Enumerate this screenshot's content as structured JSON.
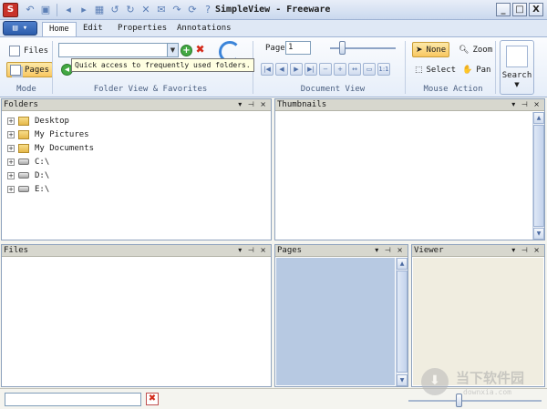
{
  "window": {
    "app_icon_letter": "S",
    "title": "SimpleView - Freeware",
    "qat_icons": [
      "undo-icon",
      "save-icon",
      "back-icon",
      "forward-icon",
      "grid-icon",
      "rotate-left-icon",
      "rotate-right-icon",
      "delete-icon",
      "email-icon",
      "redo-icon",
      "refresh-icon",
      "help-icon"
    ],
    "controls": {
      "minimize": "_",
      "maximize": "□",
      "close": "X"
    }
  },
  "tabs": [
    "Home",
    "Edit",
    "Properties",
    "Annotations"
  ],
  "active_tab": "Home",
  "ribbon": {
    "mode": {
      "label": "Mode",
      "files": "Files",
      "pages": "Pages"
    },
    "folder_view": {
      "label": "Folder View & Favorites",
      "combo_value": "",
      "tooltip": "Quick access to frequently used folders."
    },
    "document_view": {
      "label": "Document View",
      "page_label": "Page",
      "page_value": "1",
      "page_slider_fraction": 0.14,
      "nav_icons": [
        "first-page-icon",
        "prev-page-icon",
        "next-page-icon",
        "last-page-icon",
        "zoom-out-icon",
        "zoom-in-icon",
        "fit-width-icon",
        "fit-page-icon",
        "actual-size-icon"
      ]
    },
    "mouse_action": {
      "label": "Mouse Action",
      "none": "None",
      "zoom": "Zoom",
      "select": "Select",
      "pan": "Pan"
    },
    "search": {
      "label": "Search"
    }
  },
  "panes": {
    "folders": {
      "title": "Folders",
      "items": [
        {
          "label": "Desktop",
          "type": "folder"
        },
        {
          "label": "My Pictures",
          "type": "folder"
        },
        {
          "label": "My Documents",
          "type": "folder"
        },
        {
          "label": "C:\\",
          "type": "drive"
        },
        {
          "label": "D:\\",
          "type": "drive"
        },
        {
          "label": "E:\\",
          "type": "drive"
        }
      ]
    },
    "thumbnails": {
      "title": "Thumbnails"
    },
    "files": {
      "title": "Files"
    },
    "pages": {
      "title": "Pages"
    },
    "viewer": {
      "title": "Viewer"
    },
    "tool_glyphs": "▾ ⊣ ×"
  },
  "statusbar": {
    "search_value": "",
    "zoom_slider_fraction": 0.36
  },
  "watermark": {
    "cn_text": "当下软件园",
    "url": "downxia.com"
  },
  "colors": {
    "title_bar": "#cad8ee",
    "pressed_button": "#f8c761",
    "pages_background": "#b7c9e2",
    "viewer_background": "#f0ede0"
  }
}
